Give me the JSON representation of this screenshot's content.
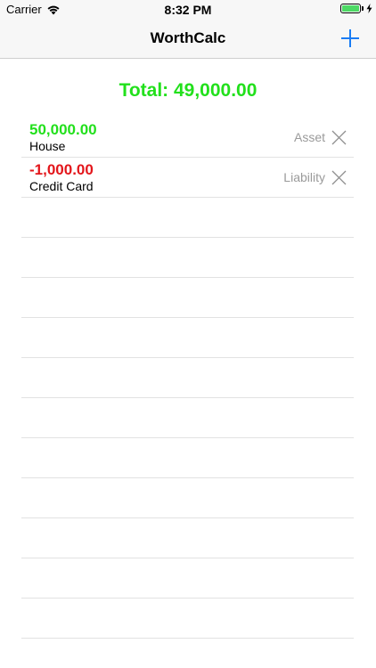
{
  "status_bar": {
    "carrier": "Carrier",
    "time": "8:32 PM",
    "battery_color": "#4cd964"
  },
  "nav": {
    "title": "WorthCalc",
    "add_icon": "plus-icon",
    "accent": "#1a7cf4"
  },
  "total": {
    "text": "Total: 49,000.00",
    "color": "#22e01c"
  },
  "items": [
    {
      "amount": "50,000.00",
      "name": "House",
      "type": "Asset",
      "amount_color": "#22e01c",
      "delete_icon": "close-icon"
    },
    {
      "amount": "-1,000.00",
      "name": "Credit Card",
      "type": "Liability",
      "amount_color": "#e3161b",
      "delete_icon": "close-icon"
    }
  ]
}
